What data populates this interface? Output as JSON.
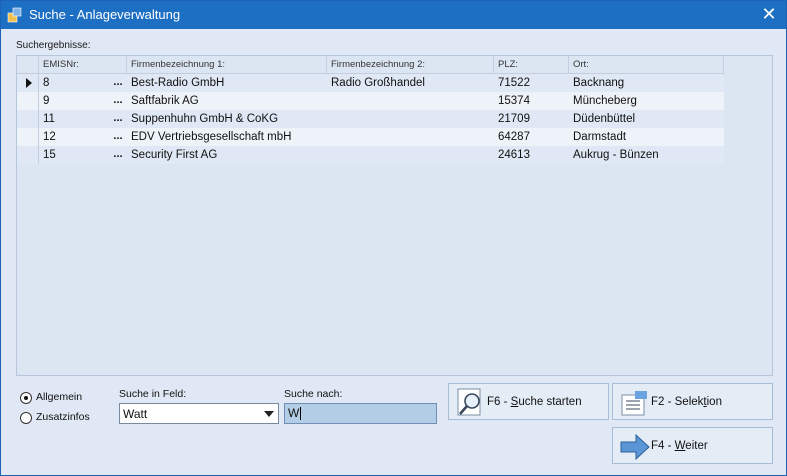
{
  "window": {
    "title": "Suche - Anlageverwaltung",
    "close_symbol": "✕"
  },
  "results": {
    "label": "Suchergebnisse:",
    "columns": [
      "EMISNr:",
      "Firmenbezeichnung 1:",
      "Firmenbezeichnung 2:",
      "PLZ:",
      "Ort:"
    ],
    "ellipsis": "...",
    "rows": [
      {
        "emisnr": "8",
        "firma1": "Best-Radio GmbH",
        "firma2": "Radio Großhandel",
        "plz": "71522",
        "ort": "Backnang",
        "selected": true
      },
      {
        "emisnr": "9",
        "firma1": "Saftfabrik AG",
        "firma2": "",
        "plz": "15374",
        "ort": "Müncheberg",
        "selected": false
      },
      {
        "emisnr": "11",
        "firma1": "Suppenhuhn GmbH & CoKG",
        "firma2": "",
        "plz": "21709",
        "ort": "Düdenbüttel",
        "selected": false
      },
      {
        "emisnr": "12",
        "firma1": "EDV Vertriebsgesellschaft mbH",
        "firma2": "",
        "plz": "64287",
        "ort": "Darmstadt",
        "selected": false
      },
      {
        "emisnr": "15",
        "firma1": "Security First AG",
        "firma2": "",
        "plz": "24613",
        "ort": "Aukrug - Bünzen",
        "selected": false
      }
    ]
  },
  "options": {
    "radio_allgemein": "Allgemein",
    "radio_zusatzinfos": "Zusatzinfos",
    "selected": "Allgemein"
  },
  "search": {
    "field_label": "Suche in Feld:",
    "field_value": "Watt",
    "query_label": "Suche nach:",
    "query_value": "W"
  },
  "buttons": {
    "suche_prefix": "F6 - ",
    "suche_underlined": "S",
    "suche_rest": "uche starten",
    "selektion_prefix": "F2 - Selek",
    "selektion_underlined": "t",
    "selektion_rest": "ion",
    "weiter_prefix": "F4 - ",
    "weiter_underlined": "W",
    "weiter_rest": "eiter"
  },
  "colors": {
    "titlebar": "#1d6fc4",
    "background": "#dfe8f4",
    "selection": "#b3cde6"
  }
}
